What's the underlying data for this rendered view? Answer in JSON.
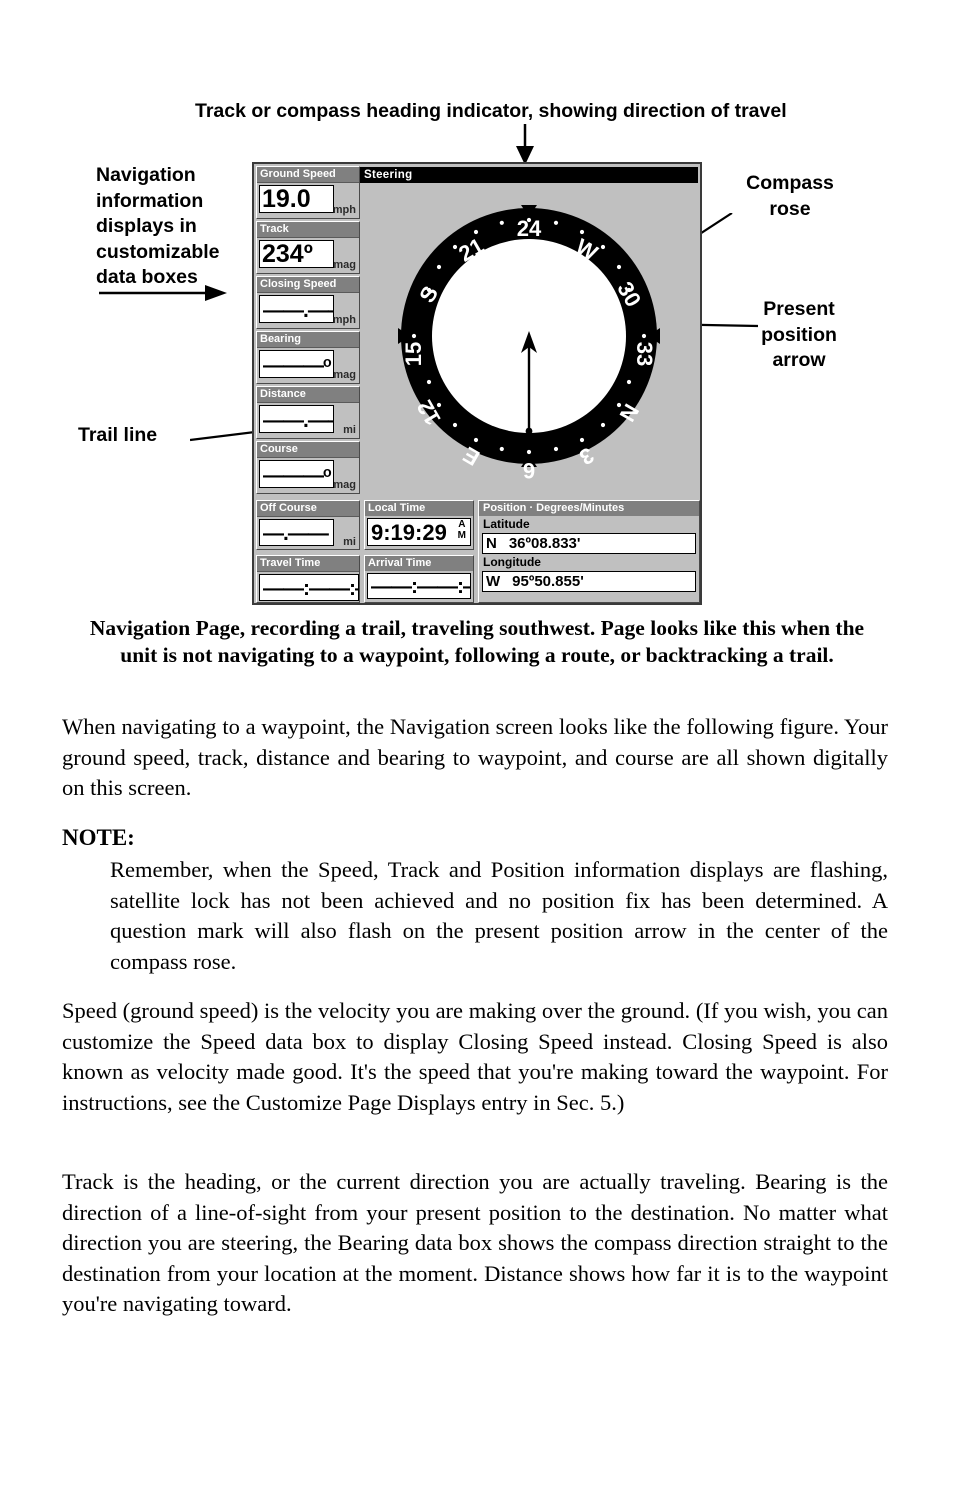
{
  "annotations": {
    "top": "Track or compass heading indicator, showing direction of travel",
    "left": "Navigation information displays in customizable data boxes",
    "trail": "Trail line",
    "compass_rose": "Compass rose",
    "present_position": "Present position arrow"
  },
  "device": {
    "title": "Steering",
    "data_boxes": [
      {
        "label": "Ground Speed",
        "value": "19.0",
        "unit": "mph",
        "style": "big"
      },
      {
        "label": "Track",
        "value": "234º",
        "unit": "mag",
        "style": "big"
      },
      {
        "label": "Closing Speed",
        "value": "——.——",
        "unit": "mph",
        "style": "dash"
      },
      {
        "label": "Bearing",
        "value": "———ᵒ",
        "unit": "mag",
        "style": "dash"
      },
      {
        "label": "Distance",
        "value": "——.——",
        "unit": "mi",
        "style": "dash"
      },
      {
        "label": "Course",
        "value": "———ᵒ",
        "unit": "mag",
        "style": "dash"
      },
      {
        "label": "Off Course",
        "value": "—.——",
        "unit": "mi",
        "style": "dash"
      },
      {
        "label": "Travel Time",
        "value": "——:——:——",
        "unit": "",
        "style": "dash"
      }
    ],
    "local_time": {
      "label": "Local Time",
      "value": "9:19:29",
      "meridiem_line1": "A",
      "meridiem_line2": "M"
    },
    "arrival_time": {
      "label": "Arrival Time",
      "value": "——:——:——"
    },
    "position": {
      "header": "Position · Degrees/Minutes",
      "latitude_label": "Latitude",
      "latitude_hemisphere": "N",
      "latitude_value": "36º08.833'",
      "longitude_label": "Longitude",
      "longitude_hemisphere": "W",
      "longitude_value": "95º50.855'"
    },
    "compass": {
      "ring_labels": [
        "24",
        "W",
        "30",
        "33",
        "N",
        "3",
        "6",
        "E",
        "12",
        "15",
        "S",
        "21"
      ],
      "heading_value": 234,
      "ring_color": "#000000",
      "face_color": "#ffffff",
      "screen_bg": "#c0c0c0",
      "header_bg": "#808080"
    }
  },
  "caption": "Navigation Page, recording a trail, traveling southwest. Page looks like this when the unit is not navigating to a waypoint, following a route, or backtracking a trail.",
  "body": {
    "p1": "When navigating to a waypoint, the Navigation screen looks like the following figure. Your ground speed, track, distance and bearing to waypoint, and course are all shown digitally on this screen.",
    "note_heading": "NOTE:",
    "note_body": "Remember, when the Speed, Track and Position information displays are flashing, satellite lock has not been achieved and no position fix has been determined. A question mark will also flash on the present position arrow in the center of the compass rose.",
    "p2": "Speed (ground speed) is the velocity you are making over the ground. (If you wish, you can customize the Speed data box to display Closing Speed instead. Closing Speed is also known as velocity made good. It's the speed that you're making toward the waypoint. For instructions, see the Customize Page Displays entry in Sec. 5.)",
    "p3": "Track is the heading, or the current direction you are actually traveling. Bearing is the direction of a line-of-sight from your present position to the destination. No matter what direction you are steering, the Bearing data box shows the compass direction straight to the destination from your location at the moment. Distance shows how far it is to the waypoint you're navigating toward."
  }
}
